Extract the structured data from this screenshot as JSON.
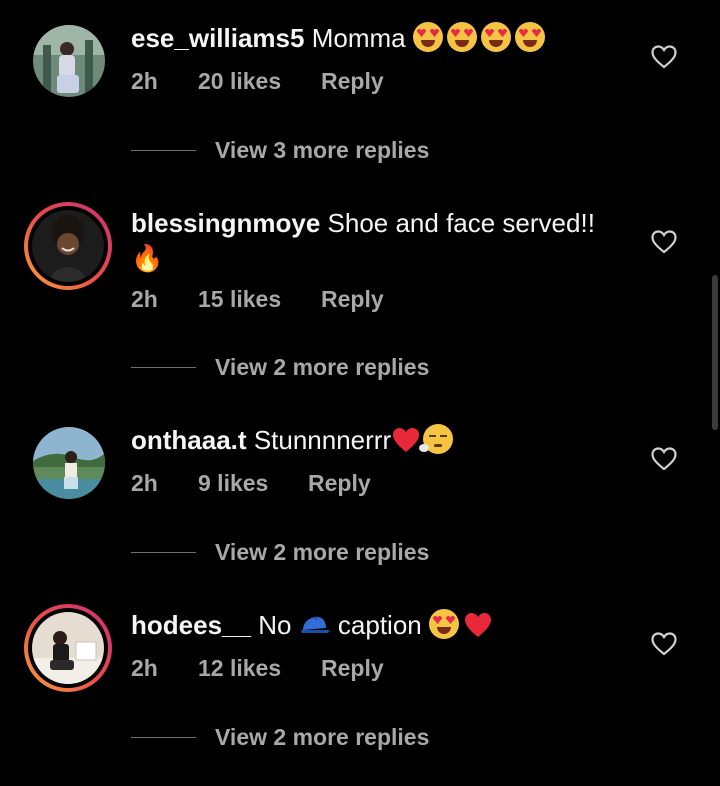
{
  "colors": {
    "background": "#000000",
    "text": "#f5f5f5",
    "muted": "#a8a8a8",
    "ring_gradient": [
      "#f9a23a",
      "#e94a4a",
      "#c9307a"
    ]
  },
  "comments": [
    {
      "username": "ese_williams5",
      "text": "Momma",
      "emoji": [
        "heart-eyes",
        "heart-eyes",
        "heart-eyes",
        "heart-eyes"
      ],
      "time": "2h",
      "likes": "20 likes",
      "reply": "Reply",
      "view_replies": "View 3 more replies",
      "story_ring": false
    },
    {
      "username": "blessingnmoye",
      "text": "Shoe and face served!!",
      "emoji": [
        "fire"
      ],
      "time": "2h",
      "likes": "15 likes",
      "reply": "Reply",
      "view_replies": "View 2 more replies",
      "story_ring": true
    },
    {
      "username": "onthaaa.t",
      "text": "Stunnnnerrr",
      "emoji": [
        "red-heart",
        "exhaling-face"
      ],
      "time": "2h",
      "likes": "9 likes",
      "reply": "Reply",
      "view_replies": "View 2 more replies",
      "story_ring": false
    },
    {
      "username": "hodees__",
      "text_before": "No",
      "text_after": "caption",
      "emoji": [
        "cap",
        "heart-eyes",
        "red-heart"
      ],
      "time": "2h",
      "likes": "12 likes",
      "reply": "Reply",
      "view_replies": "View 2 more replies",
      "story_ring": true
    }
  ],
  "icons": {
    "like": "heart-outline-icon",
    "fire": "🔥"
  }
}
